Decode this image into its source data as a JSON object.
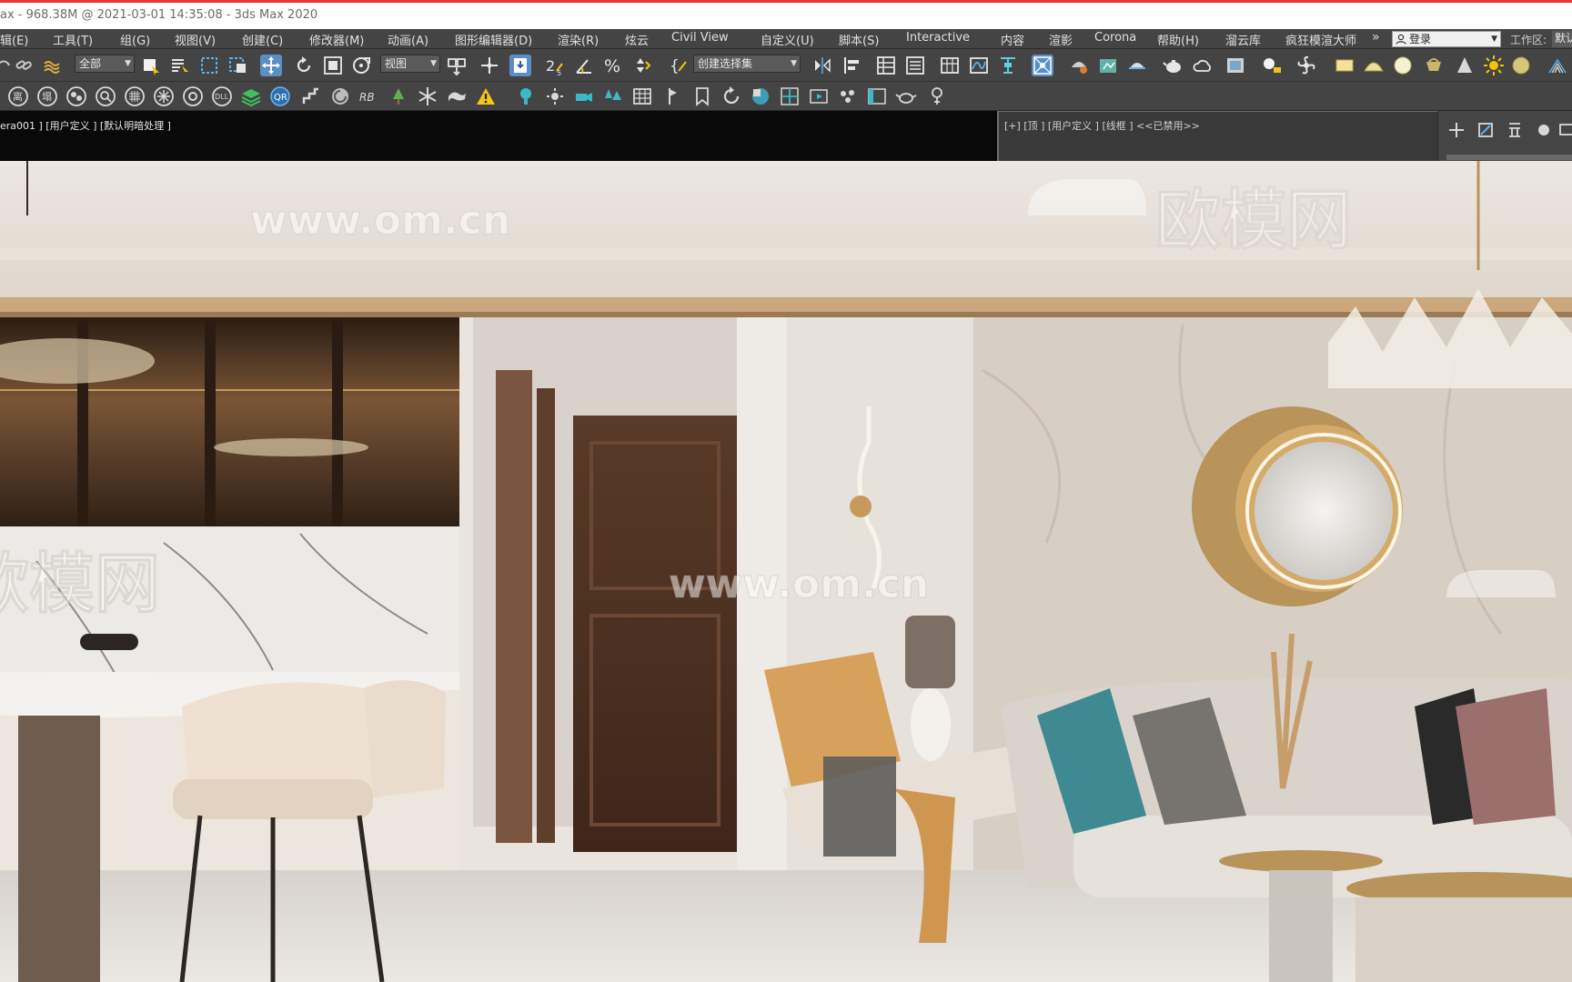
{
  "title_bar": {
    "text": "ax - 968.38M @ 2021-03-01 14:35:08 - 3ds Max 2020"
  },
  "menu": {
    "items": [
      {
        "label": "辑(E)"
      },
      {
        "label": "工具(T)"
      },
      {
        "label": "组(G)"
      },
      {
        "label": "视图(V)"
      },
      {
        "label": "创建(C)"
      },
      {
        "label": "修改器(M)"
      },
      {
        "label": "动画(A)"
      },
      {
        "label": "图形编辑器(D)"
      },
      {
        "label": "渲染(R)"
      },
      {
        "label": "炫云"
      },
      {
        "label": "Civil View"
      },
      {
        "label": "自定义(U)"
      },
      {
        "label": "脚本(S)"
      },
      {
        "label": "Interactive"
      },
      {
        "label": "内容"
      },
      {
        "label": "渲影"
      },
      {
        "label": "Corona"
      },
      {
        "label": "帮助(H)"
      },
      {
        "label": "溜云库"
      },
      {
        "label": "疯狂模渲大师"
      }
    ],
    "more": "»",
    "login": "登录",
    "workspace_label": "工作区:",
    "workspace_value": "默认"
  },
  "toolbar": {
    "selection_filter": "全部",
    "reference_coord": "视图",
    "named_selection": "创建选择集"
  },
  "viewport": {
    "main_label": "era001 ] [用户定义 ] [默认明暗处理 ]",
    "side_label": "[+] [顶 ] [用户定义 ] [线框 ] <<已禁用>>"
  },
  "render": {
    "watermark_url": "www.om.cn",
    "watermark_brand": "欧模网"
  },
  "colors": {
    "accent_active": "#5b8fc4",
    "ui_bg": "#444444"
  }
}
